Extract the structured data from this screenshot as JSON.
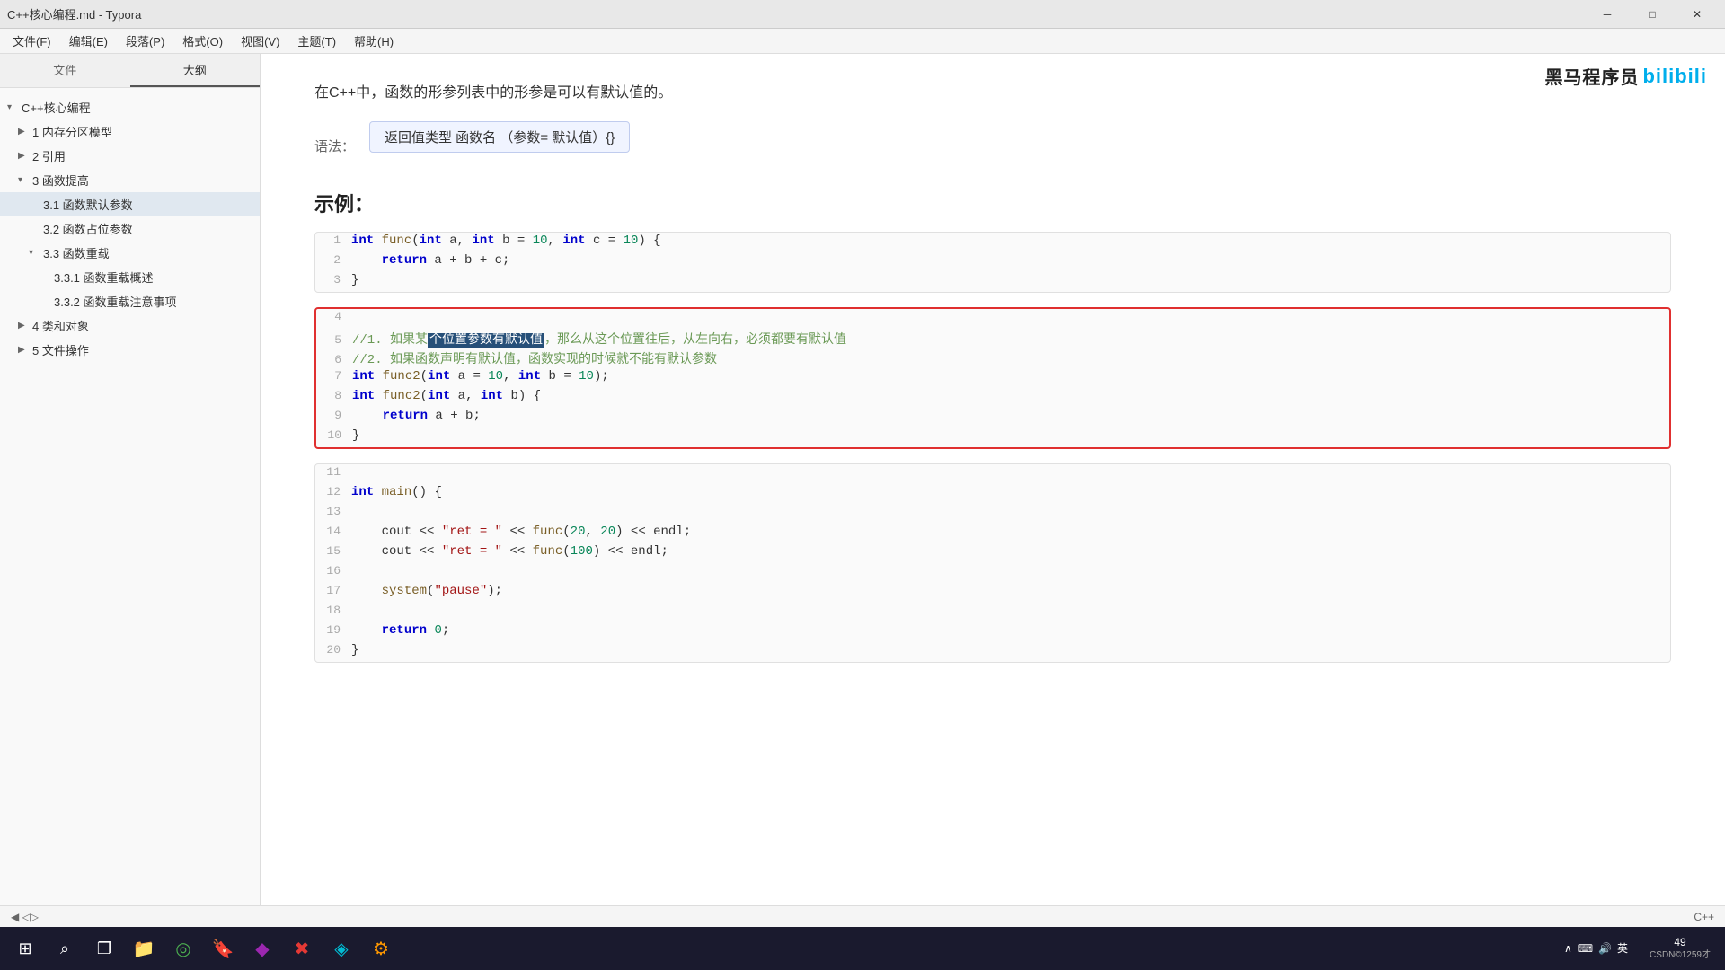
{
  "titlebar": {
    "title": "C++核心编程.md - Typora",
    "minimize_label": "─",
    "maximize_label": "□",
    "close_label": "✕"
  },
  "menubar": {
    "items": [
      "文件(F)",
      "编辑(E)",
      "段落(P)",
      "格式(O)",
      "视图(V)",
      "主题(T)",
      "帮助(H)"
    ]
  },
  "sidebar": {
    "tab_file": "文件",
    "tab_outline": "大纲",
    "tree": [
      {
        "label": "C++核心编程",
        "level": 0,
        "expanded": true,
        "arrow": "▾"
      },
      {
        "label": "1 内存分区模型",
        "level": 1,
        "expanded": false,
        "arrow": "▶"
      },
      {
        "label": "2 引用",
        "level": 1,
        "expanded": false,
        "arrow": "▶"
      },
      {
        "label": "3 函数提高",
        "level": 1,
        "expanded": true,
        "arrow": "▾"
      },
      {
        "label": "3.1 函数默认参数",
        "level": 2,
        "expanded": false,
        "arrow": "",
        "active": true
      },
      {
        "label": "3.2 函数占位参数",
        "level": 2,
        "expanded": false,
        "arrow": ""
      },
      {
        "label": "3.3 函数重载",
        "level": 2,
        "expanded": true,
        "arrow": "▾"
      },
      {
        "label": "3.3.1 函数重载概述",
        "level": 3,
        "expanded": false,
        "arrow": ""
      },
      {
        "label": "3.3.2 函数重载注意事项",
        "level": 3,
        "expanded": false,
        "arrow": ""
      },
      {
        "label": "4 类和对象",
        "level": 1,
        "expanded": false,
        "arrow": "▶"
      },
      {
        "label": "5 文件操作",
        "level": 1,
        "expanded": false,
        "arrow": "▶"
      }
    ]
  },
  "content": {
    "intro": "在C++中，函数的形参列表中的形参是可以有默认值的。",
    "syntax_label": "语法：",
    "syntax_content": "返回值类型  函数名  （参数= 默认值）{}",
    "example_title": "示例：",
    "code_normal": [
      {
        "num": "1",
        "content": "int func(int a, int b = 10, int c = 10) {"
      },
      {
        "num": "2",
        "content": "    return a + b + c;"
      },
      {
        "num": "3",
        "content": "}"
      }
    ],
    "code_highlighted": [
      {
        "num": "4",
        "content": ""
      },
      {
        "num": "5",
        "content": "//1. 如果某个位置参数有默认值，那么从这个位置往后，从左向右，必须都要有默认值",
        "has_highlight": true,
        "highlight_start": 7,
        "highlight_text": "个位置参数有默认值"
      },
      {
        "num": "6",
        "content": "//2. 如果函数声明有默认值，函数实现的时候就不能有默认参数"
      },
      {
        "num": "7",
        "content": "int func2(int a = 10, int b = 10);"
      },
      {
        "num": "8",
        "content": "int func2(int a, int b) {"
      },
      {
        "num": "9",
        "content": "    return a + b;"
      },
      {
        "num": "10",
        "content": "}"
      }
    ],
    "code_main": [
      {
        "num": "11",
        "content": ""
      },
      {
        "num": "12",
        "content": "int main() {"
      },
      {
        "num": "13",
        "content": ""
      },
      {
        "num": "14",
        "content": "    cout << \"ret = \" << func(20, 20) << endl;"
      },
      {
        "num": "15",
        "content": "    cout << \"ret = \" << func(100) << endl;"
      },
      {
        "num": "16",
        "content": ""
      },
      {
        "num": "17",
        "content": "    system(\"pause\");"
      },
      {
        "num": "18",
        "content": ""
      },
      {
        "num": "19",
        "content": "    return 0;"
      },
      {
        "num": "20",
        "content": "}"
      }
    ]
  },
  "statusbar": {
    "left": "◀  ◁▷",
    "right": "C++"
  },
  "taskbar": {
    "icons": [
      "⊞",
      "⌕",
      "❐",
      "📁",
      "◎",
      "🔖",
      "◆",
      "✖",
      "◈",
      "⚙"
    ],
    "tray": "英  ⌨  🔊  英",
    "time": "49",
    "date": "CSDN©1259才"
  }
}
